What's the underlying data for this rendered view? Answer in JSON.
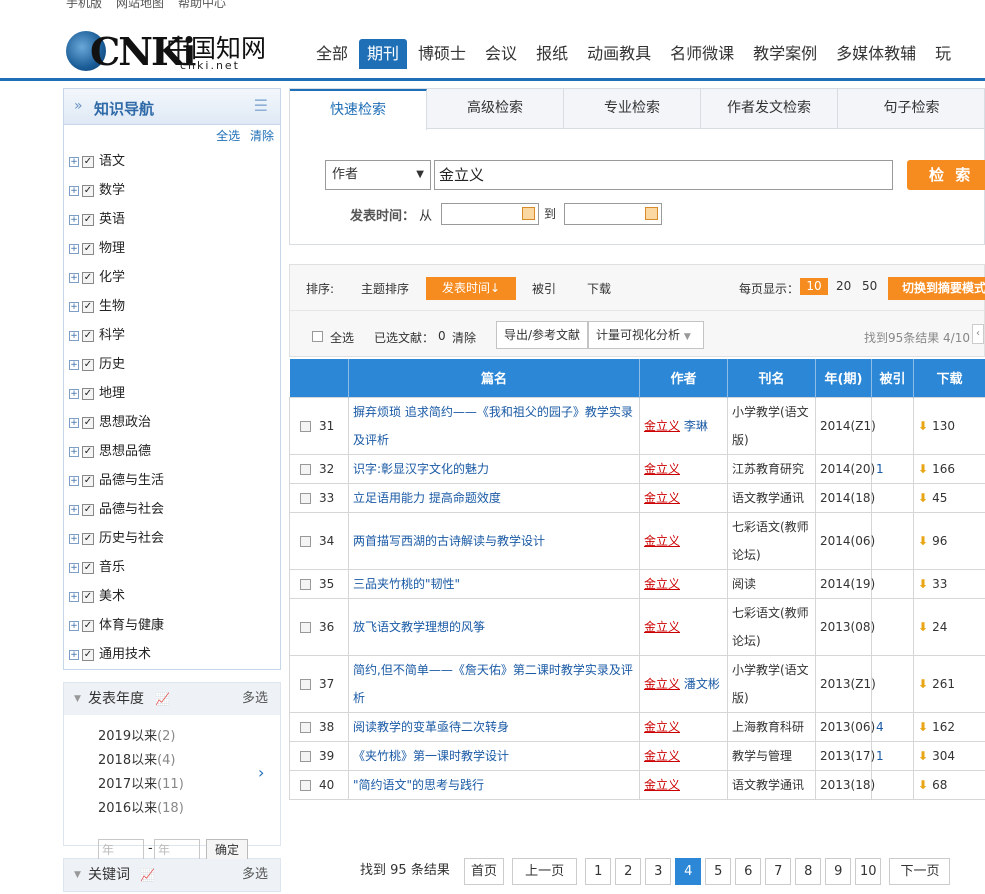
{
  "topbar": {
    "links": [
      "手机版",
      "网站地图",
      "帮助中心"
    ]
  },
  "logo": {
    "cn": "CNKi",
    "zh": "中国知网",
    "net": "cnki.net"
  },
  "nav": {
    "items": [
      "全部",
      "期刊",
      "博硕士",
      "会议",
      "报纸",
      "动画教具",
      "名师微课",
      "教学案例",
      "多媒体教辅",
      "玩"
    ],
    "active_index": 1
  },
  "sidebar": {
    "title": "知识导航",
    "select_all": "全选",
    "clear": "清除",
    "subjects": [
      "语文",
      "数学",
      "英语",
      "物理",
      "化学",
      "生物",
      "科学",
      "历史",
      "地理",
      "思想政治",
      "思想品德",
      "品德与生活",
      "品德与社会",
      "历史与社会",
      "音乐",
      "美术",
      "体育与健康",
      "通用技术"
    ],
    "year_panel": {
      "title": "发表年度",
      "more": "多选",
      "years": [
        {
          "label": "2019以来",
          "count": "(2)"
        },
        {
          "label": "2018以来",
          "count": "(4)"
        },
        {
          "label": "2017以来",
          "count": "(11)"
        },
        {
          "label": "2016以来",
          "count": "(18)"
        }
      ],
      "from_placeholder": "年",
      "to_placeholder": "年",
      "confirm": "确定"
    },
    "keyword_panel": {
      "title": "关键词",
      "more": "多选"
    }
  },
  "search": {
    "tabs": [
      "快速检索",
      "高级检索",
      "专业检索",
      "作者发文检索",
      "句子检索"
    ],
    "active_tab": 0,
    "field": "作者",
    "keyword": "金立义",
    "button": "检 索",
    "date_label": "发表时间：",
    "from": "从",
    "to": "到"
  },
  "toolbar": {
    "sort_label": "排序:",
    "sorts": [
      "主题排序",
      "发表时间↓",
      "被引",
      "下载"
    ],
    "per_page_label": "每页显示：",
    "per_page": [
      "10",
      "20",
      "50"
    ],
    "switch_btn": "切换到摘要模式",
    "select_all": "全选",
    "selected_label": "已选文献：",
    "selected_count": "0",
    "clear": "清除",
    "export": "导出/参考文献",
    "visualize": "计量可视化分析",
    "found": "找到95条结果 4/10"
  },
  "table": {
    "headers": [
      "篇名",
      "作者",
      "刊名",
      "年(期)",
      "被引",
      "下载"
    ],
    "rows": [
      {
        "no": "31",
        "title": "摒弃烦琐 追求简约——《我和祖父的园子》教学实录及评析",
        "author": "金立义",
        "coauthor": "李琳",
        "journal": "小学教学(语文版)",
        "year": "2014(Z1)",
        "cite": "",
        "dl": "130"
      },
      {
        "no": "32",
        "title": "识字:彰显汉字文化的魅力",
        "author": "金立义",
        "coauthor": "",
        "journal": "江苏教育研究",
        "year": "2014(20)",
        "cite": "1",
        "dl": "166"
      },
      {
        "no": "33",
        "title": "立足语用能力 提高命题效度",
        "author": "金立义",
        "coauthor": "",
        "journal": "语文教学通讯",
        "year": "2014(18)",
        "cite": "",
        "dl": "45"
      },
      {
        "no": "34",
        "title": "两首描写西湖的古诗解读与教学设计",
        "author": "金立义",
        "coauthor": "",
        "journal": "七彩语文(教师论坛)",
        "year": "2014(06)",
        "cite": "",
        "dl": "96"
      },
      {
        "no": "35",
        "title": "三品夹竹桃的\"韧性\"",
        "author": "金立义",
        "coauthor": "",
        "journal": "阅读",
        "year": "2014(19)",
        "cite": "",
        "dl": "33"
      },
      {
        "no": "36",
        "title": "放飞语文教学理想的风筝",
        "author": "金立义",
        "coauthor": "",
        "journal": "七彩语文(教师论坛)",
        "year": "2013(08)",
        "cite": "",
        "dl": "24"
      },
      {
        "no": "37",
        "title": "简约,但不简单——《詹天佑》第二课时教学实录及评析",
        "author": "金立义",
        "coauthor": "潘文彬",
        "journal": "小学教学(语文版)",
        "year": "2013(Z1)",
        "cite": "",
        "dl": "261"
      },
      {
        "no": "38",
        "title": "阅读教学的变革亟待二次转身",
        "author": "金立义",
        "coauthor": "",
        "journal": "上海教育科研",
        "year": "2013(06)",
        "cite": "4",
        "dl": "162"
      },
      {
        "no": "39",
        "title": "《夹竹桃》第一课时教学设计",
        "author": "金立义",
        "coauthor": "",
        "journal": "教学与管理",
        "year": "2013(17)",
        "cite": "1",
        "dl": "304"
      },
      {
        "no": "40",
        "title": "\"简约语文\"的思考与践行",
        "author": "金立义",
        "coauthor": "",
        "journal": "语文教学通讯",
        "year": "2013(18)",
        "cite": "",
        "dl": "68"
      }
    ]
  },
  "pager": {
    "found_prefix": "找到",
    "total": "95",
    "found_suffix": "条结果",
    "first": "首页",
    "prev": "上一页",
    "pages": [
      "1",
      "2",
      "3",
      "4",
      "5",
      "6",
      "7",
      "8",
      "9",
      "10"
    ],
    "current": "4",
    "next": "下一页"
  }
}
